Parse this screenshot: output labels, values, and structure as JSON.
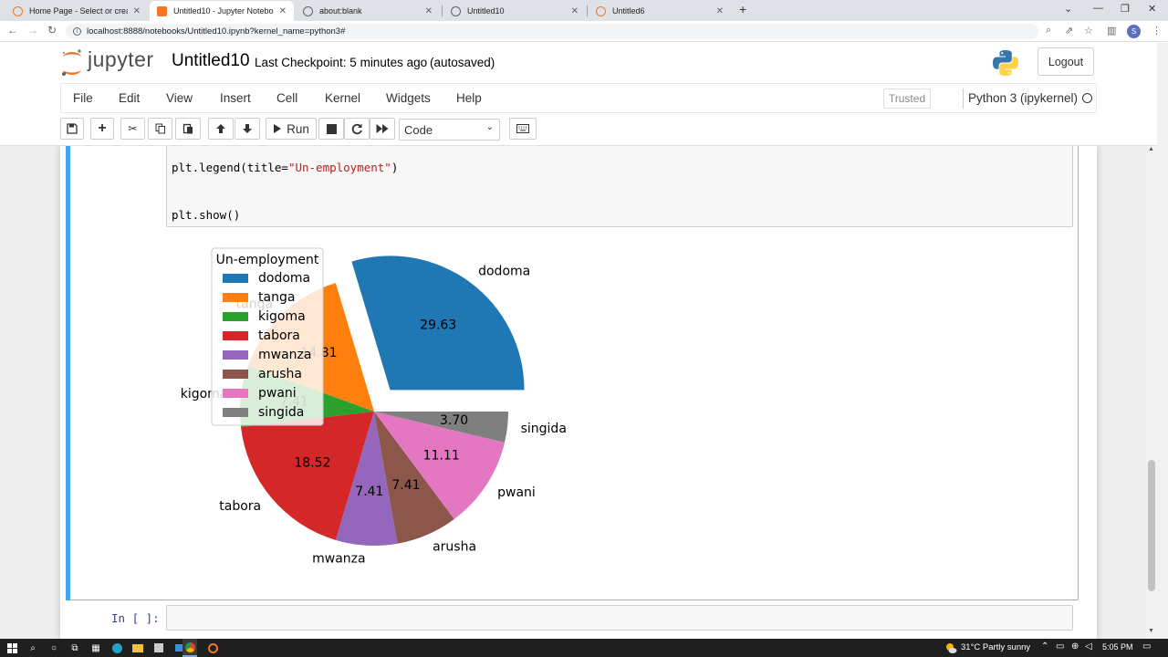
{
  "browser": {
    "tabs": [
      {
        "label": "Home Page - Select or create a n",
        "active": false
      },
      {
        "label": "Untitled10 - Jupyter Notebook",
        "active": true
      },
      {
        "label": "about:blank",
        "active": false
      },
      {
        "label": "Untitled10",
        "active": false
      },
      {
        "label": "Untitled6",
        "active": false
      }
    ],
    "new_tab": "+",
    "url": "localhost:8888/notebooks/Untitled10.ipynb?kernel_name=python3#",
    "profile_initial": "S"
  },
  "jupyter": {
    "logo_text": "jupyter",
    "notebook_title": "Untitled10",
    "checkpoint": "Last Checkpoint: 5 minutes ago",
    "autosave": "(autosaved)",
    "logout_label": "Logout",
    "menu": [
      "File",
      "Edit",
      "View",
      "Insert",
      "Cell",
      "Kernel",
      "Widgets",
      "Help"
    ],
    "trusted_label": "Trusted",
    "kernel_label": "Python 3 (ipykernel)",
    "toolbar": {
      "run_label": "Run",
      "cell_type": "Code"
    }
  },
  "cell": {
    "code_lines": [
      "plt.legend(title=",
      "\"Un-employment\"",
      ")",
      "plt.show()"
    ],
    "next_prompt": "In [ ]:"
  },
  "chart_data": {
    "type": "pie",
    "legend_title": "Un-employment",
    "legend_position": "top-left",
    "start_angle_deg": 0,
    "direction": "counterclockwise",
    "slices": [
      {
        "label": "dodoma",
        "value": 29.63,
        "pct_label": "29.63",
        "color": "#1f77b4",
        "explode": 0.2
      },
      {
        "label": "tanga",
        "value": 14.81,
        "pct_label": "14.81",
        "color": "#ff7f0e",
        "explode": 0
      },
      {
        "label": "kigoma",
        "value": 7.41,
        "pct_label": "7.41",
        "color": "#2ca02c",
        "explode": 0
      },
      {
        "label": "tabora",
        "value": 18.52,
        "pct_label": "18.52",
        "color": "#d62728",
        "explode": 0
      },
      {
        "label": "mwanza",
        "value": 7.41,
        "pct_label": "7.41",
        "color": "#9467bd",
        "explode": 0
      },
      {
        "label": "arusha",
        "value": 7.41,
        "pct_label": "7.41",
        "color": "#8c564b",
        "explode": 0
      },
      {
        "label": "pwani",
        "value": 11.11,
        "pct_label": "11.11",
        "color": "#e377c2",
        "explode": 0
      },
      {
        "label": "singida",
        "value": 3.7,
        "pct_label": "3.70",
        "color": "#7f7f7f",
        "explode": 0
      }
    ]
  },
  "taskbar": {
    "weather": "31°C  Partly sunny",
    "time": "5:05 PM"
  }
}
